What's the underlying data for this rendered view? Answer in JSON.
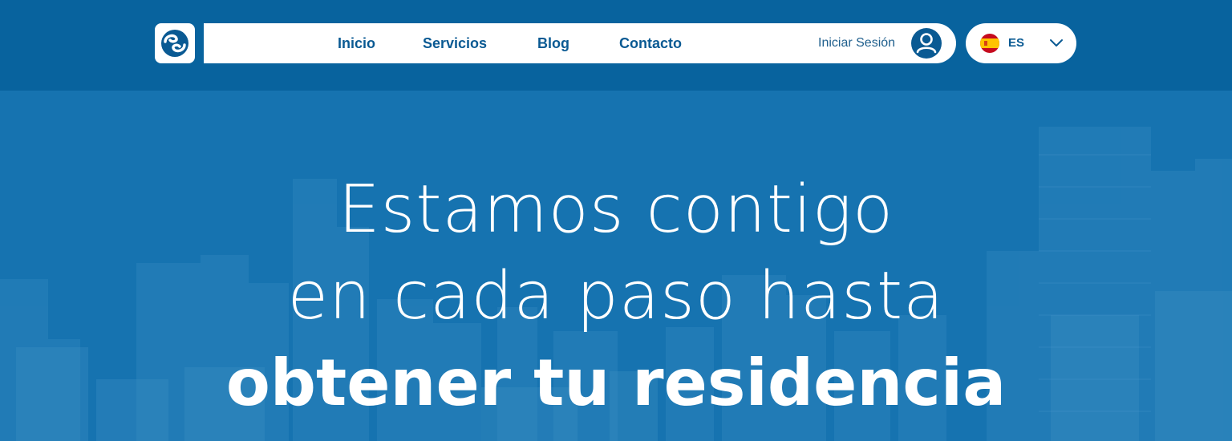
{
  "nav": {
    "links": [
      "Inicio",
      "Servicios",
      "Blog",
      "Contacto"
    ],
    "login_label": "Iniciar Sesión"
  },
  "language": {
    "code": "ES",
    "flag": "spain-flag-icon"
  },
  "hero": {
    "line1": "Estamos contigo",
    "line2": "en cada paso hasta",
    "line3": "obtener tu residencia"
  },
  "colors": {
    "header_bg": "#08639e",
    "hero_overlay": "#1673b0",
    "brand_blue": "#0a5a93",
    "white": "#ffffff"
  },
  "icons": {
    "logo": "brand-logo-icon",
    "user": "user-avatar-icon",
    "dropdown": "chevron-down-icon"
  }
}
